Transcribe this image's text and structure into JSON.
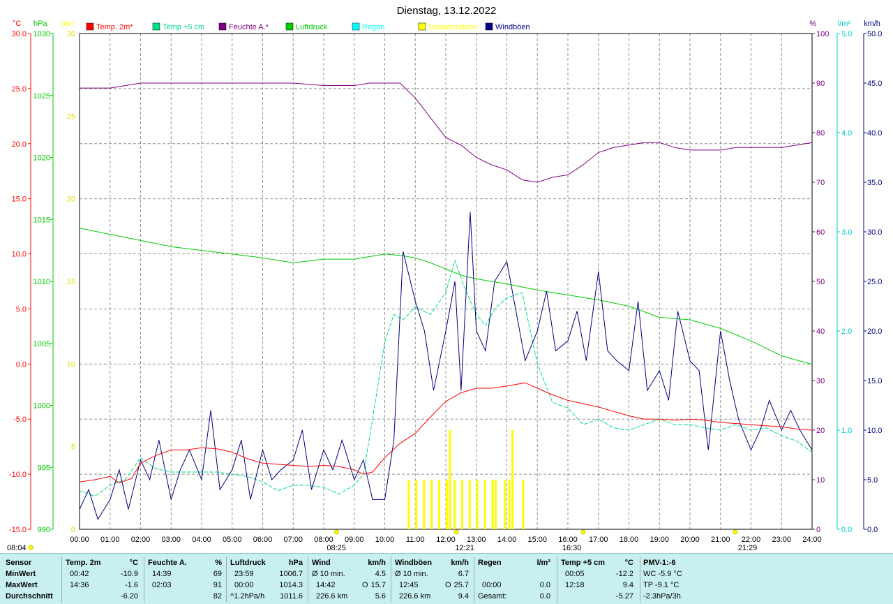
{
  "title": "Dienstag, 13.12.2022",
  "axes": {
    "temp_unit": "°C",
    "hpa_unit": "hPa",
    "min_unit": "min",
    "pct_unit": "%",
    "rain_unit": "l/m²",
    "kmh_unit": "km/h",
    "temp_ticks": [
      "30.0",
      "25.0",
      "20.0",
      "15.0",
      "10.0",
      "5.0",
      "0.0",
      "-5.0",
      "-10.0",
      "-15.0"
    ],
    "hpa_ticks": [
      "1030",
      "1025",
      "1020",
      "1015",
      "1010",
      "1005",
      "1000",
      "995",
      "990"
    ],
    "min_ticks": [
      "30",
      "25",
      "20",
      "15",
      "10",
      "5",
      "0"
    ],
    "pct_ticks": [
      "100",
      "90",
      "80",
      "70",
      "60",
      "50",
      "40",
      "30",
      "20",
      "10",
      "0"
    ],
    "rain_ticks": [
      "5.0",
      "4.0",
      "3.0",
      "2.0",
      "1.0",
      "0.0"
    ],
    "kmh_ticks": [
      "50.0",
      "45.0",
      "40.0",
      "35.0",
      "30.0",
      "25.0",
      "20.0",
      "15.0",
      "10.0",
      "5.0",
      "0.0"
    ],
    "hour_labels": [
      "00:00",
      "01:00",
      "02:00",
      "03:00",
      "04:00",
      "05:00",
      "06:00",
      "07:00",
      "08:00",
      "09:00",
      "10:00",
      "11:00",
      "12:00",
      "13:00",
      "14:00",
      "15:00",
      "16:00",
      "17:00",
      "18:00",
      "19:00",
      "20:00",
      "21:00",
      "22:00",
      "23:00",
      "24:00"
    ]
  },
  "legend": [
    {
      "name": "Temp. 2m*",
      "color": "#ff0000",
      "text_color": "#ff0000"
    },
    {
      "name": "Temp +5 cm",
      "color": "#00dd88",
      "text_color": "#00dd88"
    },
    {
      "name": "Feuchte A.*",
      "color": "#800080",
      "text_color": "#800080"
    },
    {
      "name": "Luftdruck",
      "color": "#00cc00",
      "text_color": "#00cc00"
    },
    {
      "name": "Regen",
      "color": "#00ffff",
      "text_color": "#00ffff"
    },
    {
      "name": "Sonnenschein",
      "color": "#ffff00",
      "text_color": "#ffff00"
    },
    {
      "name": "Windböen",
      "color": "#000080",
      "text_color": "#000080"
    }
  ],
  "sun_markers": [
    {
      "label": "08:04",
      "type": "sunrise-start"
    },
    {
      "label": "08:25",
      "type": "sunrise"
    },
    {
      "label": "12:21",
      "type": "noon"
    },
    {
      "label": "16:30",
      "type": "sunset"
    },
    {
      "label": "21:29",
      "type": "moon"
    }
  ],
  "chart_data": {
    "type": "line",
    "title": "Dienstag, 13.12.2022",
    "x_unit": "hours",
    "xlim": [
      0,
      24
    ],
    "series": [
      {
        "name": "Temp. 2m*",
        "unit": "°C",
        "ylim": [
          -15,
          30
        ],
        "x": [
          0,
          0.5,
          1,
          1.3,
          1.7,
          2,
          2.5,
          3,
          3.5,
          4,
          4.5,
          5,
          5.5,
          6,
          6.5,
          7,
          7.5,
          8,
          8.5,
          9,
          9.3,
          9.6,
          10,
          10.5,
          11,
          11.5,
          12,
          12.5,
          13,
          13.5,
          14,
          14.6,
          15,
          15.5,
          16,
          16.5,
          17,
          17.5,
          18,
          18.5,
          19,
          19.5,
          20,
          20.5,
          21,
          21.5,
          22,
          22.5,
          23,
          23.5,
          24
        ],
        "y": [
          -10.7,
          -10.5,
          -10.2,
          -10.8,
          -10.4,
          -9.0,
          -8.3,
          -7.8,
          -7.8,
          -7.6,
          -7.7,
          -8.0,
          -8.6,
          -9.0,
          -9.1,
          -9.2,
          -9.3,
          -9.2,
          -9.3,
          -9.6,
          -10.0,
          -9.8,
          -8.5,
          -7.2,
          -6.3,
          -4.8,
          -3.4,
          -2.6,
          -2.2,
          -2.2,
          -2.0,
          -1.7,
          -2.2,
          -2.8,
          -3.3,
          -3.6,
          -3.9,
          -4.3,
          -4.7,
          -5.0,
          -5.0,
          -5.1,
          -5.0,
          -5.1,
          -5.3,
          -5.4,
          -5.5,
          -5.6,
          -5.7,
          -5.9,
          -6.0
        ]
      },
      {
        "name": "Temp +5 cm",
        "unit": "°C",
        "ylim": [
          -15,
          30
        ],
        "x": [
          0,
          0.5,
          1,
          1.5,
          2,
          2.5,
          3,
          3.5,
          4,
          4.5,
          5,
          5.5,
          6,
          6.5,
          7,
          7.5,
          8,
          8.5,
          9,
          9.3,
          9.6,
          10,
          10.3,
          10.6,
          11,
          11.5,
          12,
          12.3,
          12.6,
          13,
          13.3,
          13.6,
          14,
          14.5,
          15,
          15.5,
          16,
          16.5,
          17,
          17.5,
          18,
          18.5,
          19,
          19.5,
          20,
          20.5,
          21,
          21.5,
          22,
          22.5,
          23,
          23.5,
          24
        ],
        "y": [
          -11.5,
          -12.0,
          -11.0,
          -10.5,
          -8.5,
          -9.5,
          -9.8,
          -9.8,
          -9.8,
          -9.8,
          -10.0,
          -10.2,
          -10.7,
          -11.5,
          -11.0,
          -11.0,
          -11.2,
          -11.8,
          -11.0,
          -10.0,
          -5.0,
          2.0,
          4.5,
          4.0,
          5.2,
          4.5,
          6.5,
          9.4,
          7.0,
          4.5,
          3.5,
          5.0,
          6.0,
          6.5,
          0.0,
          -3.5,
          -4.0,
          -5.5,
          -5.0,
          -5.8,
          -6.0,
          -5.5,
          -5.0,
          -5.5,
          -5.5,
          -5.8,
          -6.0,
          -5.5,
          -6.0,
          -5.8,
          -6.5,
          -7.0,
          -8.0
        ]
      },
      {
        "name": "Feuchte A.*",
        "unit": "%",
        "ylim": [
          0,
          100
        ],
        "x": [
          0,
          1,
          2,
          3,
          4,
          5,
          6,
          7,
          8,
          9,
          9.5,
          10,
          10.5,
          11,
          11.5,
          12,
          12.5,
          13,
          13.5,
          14,
          14.5,
          15,
          15.5,
          16,
          16.5,
          17,
          17.5,
          18,
          18.5,
          19,
          19.5,
          20,
          20.5,
          21,
          21.5,
          22,
          22.5,
          23,
          23.5,
          24
        ],
        "y": [
          89.0,
          89.0,
          90.0,
          90.0,
          90.0,
          90.0,
          90.0,
          90.0,
          89.5,
          89.5,
          90.0,
          90.0,
          90.0,
          87.0,
          83.0,
          79.0,
          77.5,
          75.0,
          73.5,
          72.5,
          70.5,
          70.0,
          71.0,
          71.5,
          73.5,
          76.0,
          77.0,
          77.5,
          78.0,
          78.0,
          77.0,
          76.5,
          76.5,
          76.5,
          77.0,
          77.0,
          77.0,
          77.0,
          77.5,
          78.0
        ]
      },
      {
        "name": "Luftdruck",
        "unit": "hPa",
        "ylim": [
          990,
          1030
        ],
        "x": [
          0,
          1,
          2,
          3,
          4,
          5,
          6,
          7,
          8,
          9,
          10,
          10.5,
          11,
          11.5,
          12,
          12.5,
          13,
          14,
          15,
          16,
          17,
          18,
          19,
          20,
          21,
          22,
          23,
          24
        ],
        "y": [
          1014.3,
          1013.8,
          1013.3,
          1012.8,
          1012.5,
          1012.2,
          1011.9,
          1011.5,
          1011.8,
          1011.8,
          1012.2,
          1012.1,
          1011.9,
          1011.5,
          1011.0,
          1010.5,
          1010.2,
          1009.8,
          1009.3,
          1008.9,
          1008.5,
          1008.0,
          1007.1,
          1006.9,
          1006.2,
          1005.2,
          1004.0,
          1003.3
        ]
      },
      {
        "name": "Windböen",
        "unit": "km/h",
        "ylim": [
          0,
          50
        ],
        "x": [
          0,
          0.3,
          0.6,
          1,
          1.3,
          1.6,
          2,
          2.3,
          2.6,
          3,
          3.3,
          3.6,
          4,
          4.3,
          4.6,
          5,
          5.3,
          5.6,
          6,
          6.3,
          6.6,
          7,
          7.3,
          7.6,
          8,
          8.3,
          8.6,
          9,
          9.3,
          9.6,
          10,
          10.3,
          10.6,
          11,
          11.3,
          11.6,
          12,
          12.3,
          12.5,
          12.8,
          13,
          13.3,
          13.6,
          14,
          14.3,
          14.6,
          15,
          15.3,
          15.6,
          16,
          16.3,
          16.6,
          17,
          17.3,
          17.6,
          18,
          18.3,
          18.6,
          19,
          19.3,
          19.6,
          20,
          20.3,
          20.6,
          21,
          21.3,
          21.6,
          22,
          22.3,
          22.6,
          23,
          23.3,
          23.6,
          24
        ],
        "y": [
          2,
          4,
          1,
          3,
          6,
          2,
          7,
          5,
          9,
          3,
          6,
          8,
          5,
          12,
          4,
          6,
          9,
          3,
          8,
          5,
          6,
          7,
          10,
          4,
          8,
          6,
          9,
          5,
          7,
          3,
          3,
          9,
          28,
          23,
          20,
          14,
          20,
          25,
          14,
          32,
          20,
          18,
          25,
          27,
          22,
          17,
          20,
          24,
          18,
          19,
          22,
          17,
          26,
          18,
          17,
          16,
          23,
          14,
          16,
          13,
          22,
          17,
          16,
          8,
          20,
          15,
          11,
          8,
          10,
          13,
          10,
          12,
          10,
          8
        ]
      },
      {
        "name": "Sonnenschein",
        "unit": "min",
        "ylim": [
          0,
          30
        ],
        "x": [
          10.75,
          11,
          11.25,
          11.5,
          11.75,
          12,
          12.1,
          12.25,
          12.5,
          12.75,
          13,
          13.25,
          13.5,
          13.6,
          13.9,
          14.05,
          14.15,
          14.5
        ],
        "y": [
          3,
          3,
          3,
          3,
          3,
          3,
          6,
          3,
          3,
          3,
          3,
          3,
          3,
          3,
          3,
          3,
          6,
          3
        ]
      }
    ]
  },
  "stats": {
    "sensor": {
      "head": "Sensor",
      "min": "MinWert",
      "max": "MaxWert",
      "avg": "Durchschnitt"
    },
    "temp2m": {
      "head": "Temp. 2m",
      "unit": "°C",
      "min_t": "00:42",
      "min_v": "-10.9",
      "max_t": "14:36",
      "max_v": "-1.6",
      "avg_v": "-6.20"
    },
    "feuchte": {
      "head": "Feuchte A.",
      "unit": "%",
      "min_t": "14:39",
      "min_v": "69",
      "max_t": "02:03",
      "max_v": "91",
      "avg_v": "82"
    },
    "luftdruck": {
      "head": "Luftdruck",
      "unit": "hPa",
      "min_t": "23:59",
      "min_v": "1006.7",
      "max_t": "00:00",
      "max_v": "1014.3",
      "avg_t": "^1.2hPa/h",
      "avg_v": "1011.6"
    },
    "wind": {
      "head": "Wind",
      "unit": "km/h",
      "min_t": "Ø 10 min.",
      "min_v": "4.5",
      "max_t": "14:42",
      "max_dir": "O",
      "max_v": "15.7",
      "avg_t": "226.6 km",
      "avg_v": "5.6"
    },
    "boeen": {
      "head": "Windböen",
      "unit": "km/h",
      "min_t": "Ø 10 min.",
      "min_v": "6.7",
      "max_t": "12:45",
      "max_dir": "O",
      "max_v": "25.7",
      "avg_t": "226.6 km",
      "avg_v": "9.4"
    },
    "regen": {
      "head": "Regen",
      "unit": "l/m²",
      "max_t": "00:00",
      "max_v": "0.0",
      "avg_t": "Gesamt:",
      "avg_v": "0.0"
    },
    "temp5": {
      "head": "Temp +5 cm",
      "unit": "°C",
      "min_t": "00:05",
      "min_v": "-12.2",
      "max_t": "12:18",
      "max_v": "9.4",
      "avg_v": "-5.27"
    },
    "pmv": {
      "head": "PMV-1:-6",
      "wc": "WC -5.9 °C",
      "tp": "TP -9.1 °C",
      "trend": "-2.3hPa/3h"
    }
  }
}
